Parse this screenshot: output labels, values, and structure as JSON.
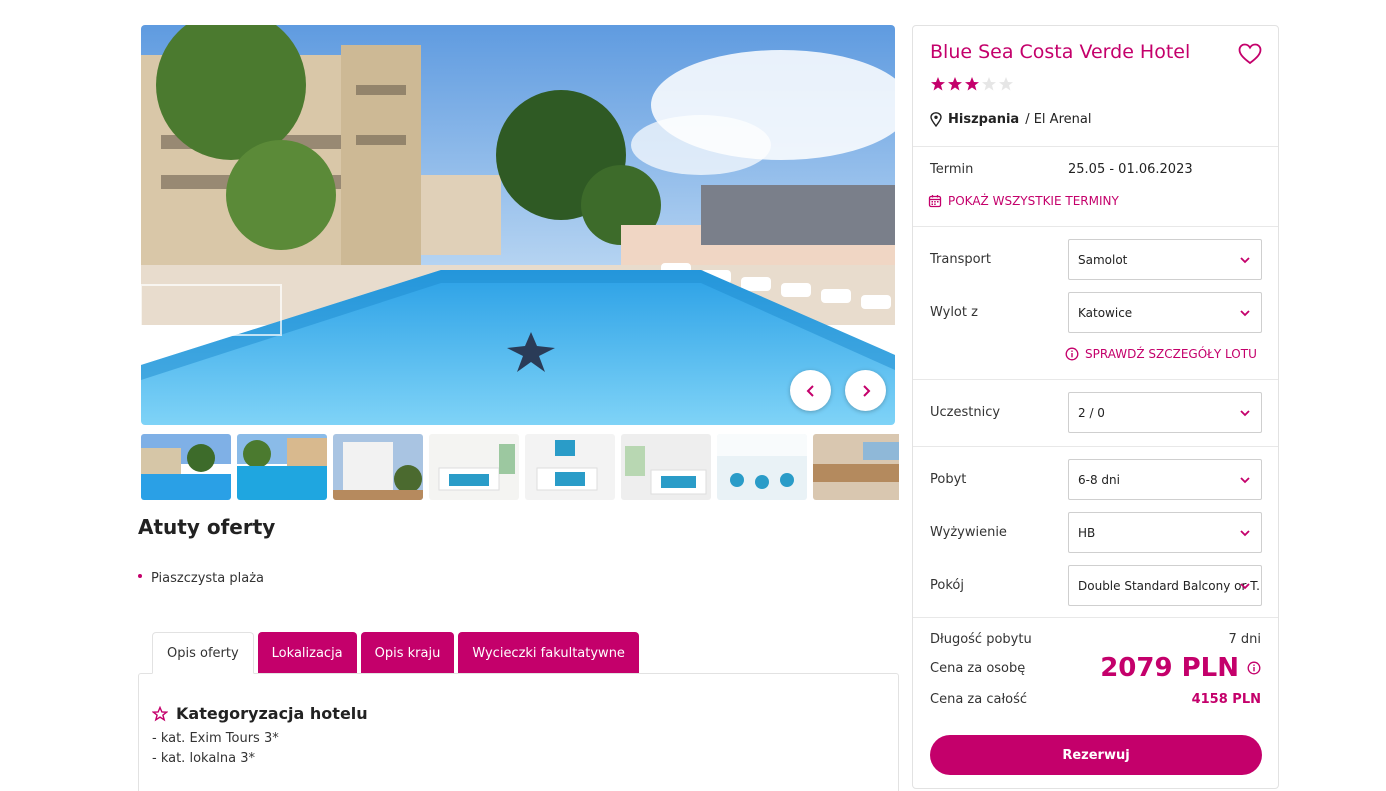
{
  "colors": {
    "accent": "#c4006b",
    "border": "#e2e2e2"
  },
  "gallery": {
    "prev_icon": "chevron-left-icon",
    "next_icon": "chevron-right-icon",
    "thumb_count": 8
  },
  "atuty": {
    "title": "Atuty oferty",
    "items": [
      "Piaszczysta plaża"
    ]
  },
  "tabs": [
    {
      "label": "Opis oferty",
      "active": true
    },
    {
      "label": "Lokalizacja",
      "active": false
    },
    {
      "label": "Opis kraju",
      "active": false
    },
    {
      "label": "Wycieczki fakultatywne",
      "active": false
    }
  ],
  "description": {
    "section_title": "Kategoryzacja hotelu",
    "section_icon": "star-outline-icon",
    "lines": [
      "- kat. Exim Tours 3*",
      "- kat. lokalna 3*"
    ]
  },
  "hotel": {
    "name": "Blue Sea Costa Verde Hotel",
    "stars": 3,
    "stars_max": 5,
    "country": "Hiszpania",
    "city": "/ El Arenal",
    "favorite_icon": "heart-outline-icon"
  },
  "term": {
    "label": "Termin",
    "value": "25.05 - 01.06.2023",
    "link": "POKAŻ WSZYSTKIE TERMINY"
  },
  "transport": {
    "label": "Transport",
    "value": "Samolot",
    "from_label": "Wylot z",
    "from_value": "Katowice",
    "details_link": "SPRAWDŹ SZCZEGÓŁY LOTU"
  },
  "participants": {
    "label": "Uczestnicy",
    "value": "2 / 0"
  },
  "stay": {
    "duration_label": "Pobyt",
    "duration_value": "6-8 dni",
    "board_label": "Wyżywienie",
    "board_value": "HB",
    "room_label": "Pokój",
    "room_value": "Double Standard Balcony or T..."
  },
  "pricing": {
    "length_label": "Długość pobytu",
    "length_value": "7 dni",
    "per_person_label": "Cena za osobę",
    "per_person_value": "2079 PLN",
    "total_label": "Cena za całość",
    "total_value": "4158 PLN"
  },
  "cta": {
    "label": "Rezerwuj"
  }
}
